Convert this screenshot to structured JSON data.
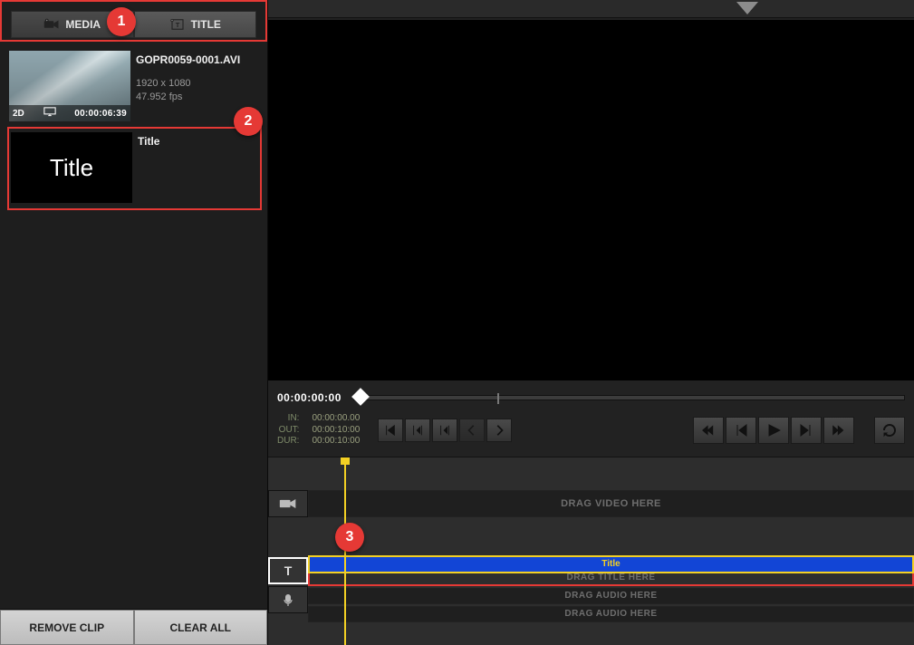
{
  "tabs": {
    "media": "MEDIA",
    "title": "TITLE"
  },
  "clips": [
    {
      "name": "GOPR0059-0001.AVI",
      "resolution": "1920 x 1080",
      "fps": "47.952 fps",
      "badge_mode": "2D",
      "badge_duration": "00:00:06:39",
      "thumb_word": ""
    },
    {
      "name": "Title",
      "resolution": "",
      "fps": "",
      "badge_mode": "",
      "badge_duration": "",
      "thumb_word": "Title"
    }
  ],
  "buttons": {
    "remove": "REMOVE CLIP",
    "clear": "CLEAR ALL"
  },
  "transport": {
    "timecode": "00:00:00:00",
    "labels": {
      "in": "IN:",
      "out": "OUT:",
      "dur": "DUR:"
    },
    "in": "00:00:00.00",
    "out": "00:00:10:00",
    "dur": "00:00:10:00"
  },
  "timeline": {
    "video_placeholder": "DRAG VIDEO HERE",
    "title_clip_label": "Title",
    "title_placeholder": "DRAG TITLE HERE",
    "audio_placeholder": "DRAG AUDIO HERE"
  },
  "badges": {
    "b1": "1",
    "b2": "2",
    "b3": "3"
  }
}
